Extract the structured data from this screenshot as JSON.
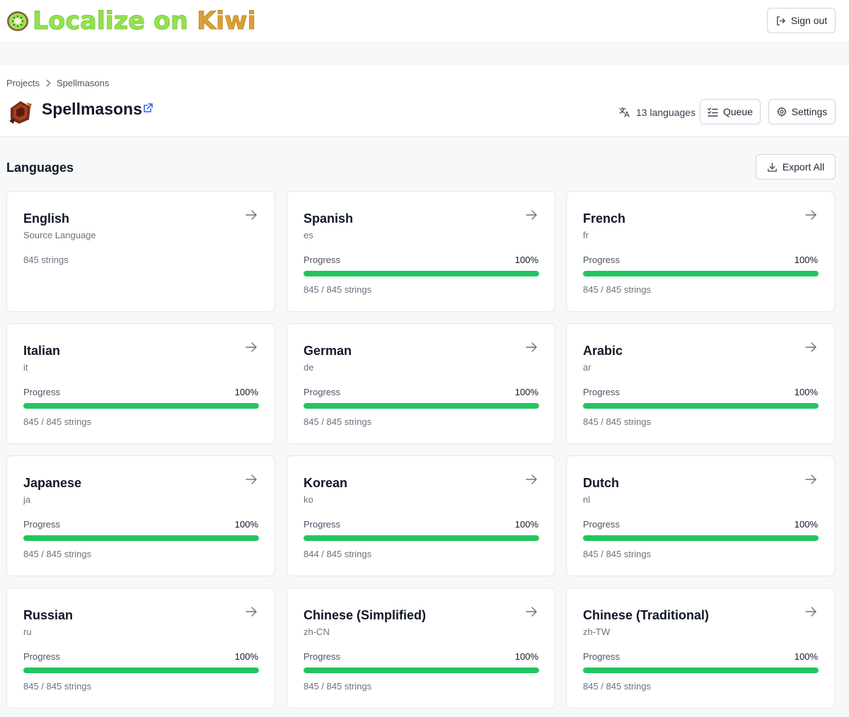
{
  "header": {
    "logo_words": [
      "Localize",
      "on",
      "Kiwi"
    ],
    "sign_out_label": "Sign out"
  },
  "breadcrumb": {
    "root": "Projects",
    "current": "Spellmasons"
  },
  "project": {
    "title": "Spellmasons",
    "language_count_label": "13 languages",
    "queue_label": "Queue",
    "settings_label": "Settings"
  },
  "languages_section": {
    "title": "Languages",
    "export_all_label": "Export All"
  },
  "colors": {
    "accent_green": "#22c55e",
    "logo_green": "#93e24f",
    "logo_gold": "#d9a13a"
  },
  "languages": [
    {
      "name": "English",
      "code": "Source Language",
      "source": true,
      "count": "845 strings"
    },
    {
      "name": "Spanish",
      "code": "es",
      "progress_label": "Progress",
      "progress_value": "100%",
      "progress": 1.0,
      "count": "845 / 845 strings"
    },
    {
      "name": "French",
      "code": "fr",
      "progress_label": "Progress",
      "progress_value": "100%",
      "progress": 1.0,
      "count": "845 / 845 strings"
    },
    {
      "name": "Italian",
      "code": "it",
      "progress_label": "Progress",
      "progress_value": "100%",
      "progress": 1.0,
      "count": "845 / 845 strings"
    },
    {
      "name": "German",
      "code": "de",
      "progress_label": "Progress",
      "progress_value": "100%",
      "progress": 1.0,
      "count": "845 / 845 strings"
    },
    {
      "name": "Arabic",
      "code": "ar",
      "progress_label": "Progress",
      "progress_value": "100%",
      "progress": 1.0,
      "count": "845 / 845 strings"
    },
    {
      "name": "Japanese",
      "code": "ja",
      "progress_label": "Progress",
      "progress_value": "100%",
      "progress": 1.0,
      "count": "845 / 845 strings"
    },
    {
      "name": "Korean",
      "code": "ko",
      "progress_label": "Progress",
      "progress_value": "100%",
      "progress": 0.9988,
      "count": "844 / 845 strings"
    },
    {
      "name": "Dutch",
      "code": "nl",
      "progress_label": "Progress",
      "progress_value": "100%",
      "progress": 1.0,
      "count": "845 / 845 strings"
    },
    {
      "name": "Russian",
      "code": "ru",
      "progress_label": "Progress",
      "progress_value": "100%",
      "progress": 1.0,
      "count": "845 / 845 strings"
    },
    {
      "name": "Chinese (Simplified)",
      "code": "zh-CN",
      "progress_label": "Progress",
      "progress_value": "100%",
      "progress": 1.0,
      "count": "845 / 845 strings"
    },
    {
      "name": "Chinese (Traditional)",
      "code": "zh-TW",
      "progress_label": "Progress",
      "progress_value": "100%",
      "progress": 1.0,
      "count": "845 / 845 strings"
    }
  ]
}
